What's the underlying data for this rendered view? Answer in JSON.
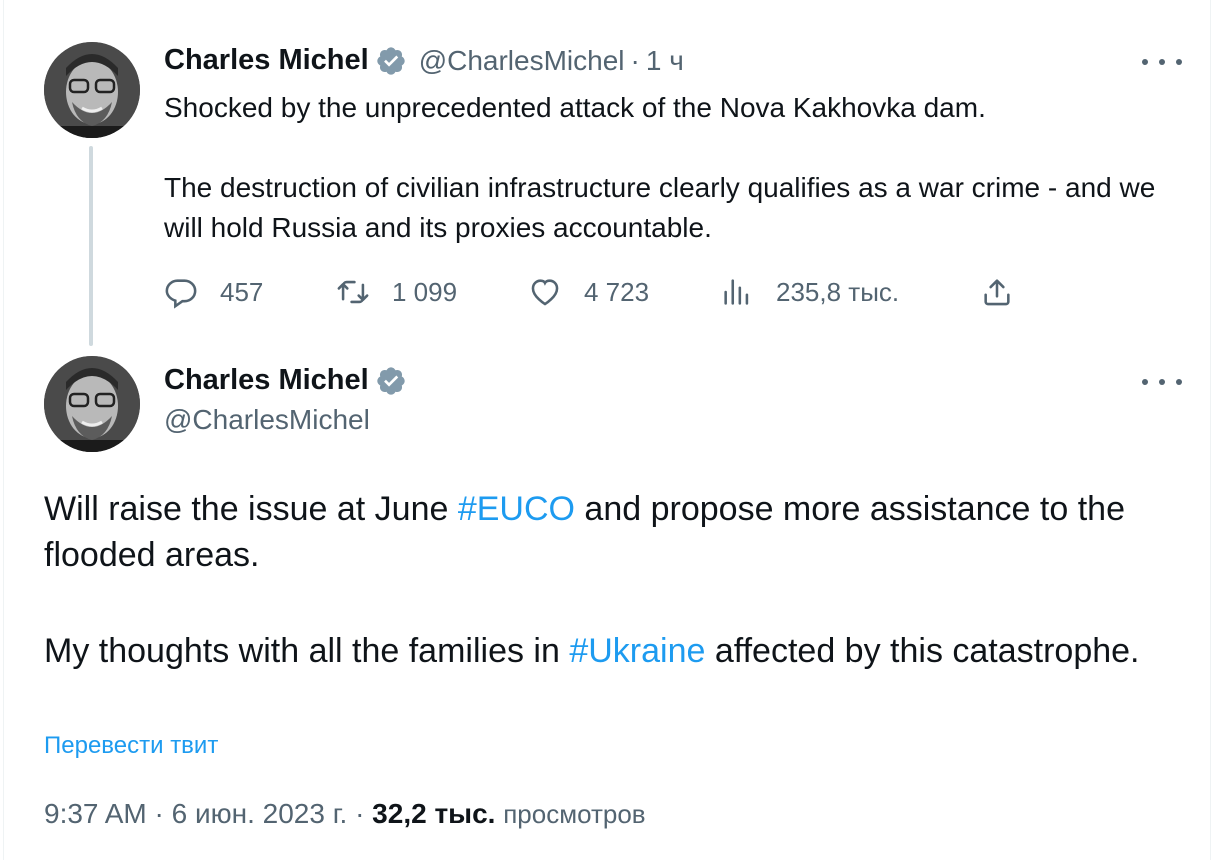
{
  "tweet1": {
    "author_name": "Charles Michel",
    "handle": "@CharlesMichel",
    "separator": "·",
    "time": "1 ч",
    "text": [
      "Shocked by the unprecedented attack of the Nova Kakhovka dam.",
      "The destruction of civilian infrastructure clearly qualifies as a war crime - and we will hold Russia and its proxies accountable."
    ],
    "replies": "457",
    "retweets": "1 099",
    "likes": "4 723",
    "views": "235,8 тыс."
  },
  "tweet2": {
    "author_name": "Charles Michel",
    "handle": "@CharlesMichel",
    "text": {
      "p1_before": "Will raise the issue at June ",
      "p1_hashtag": "#EUCO",
      "p1_after": " and propose more assistance to the flooded areas.",
      "p2_before": "My thoughts with all the families in ",
      "p2_hashtag": "#Ukraine",
      "p2_after": " affected by this catastrophe."
    },
    "translate_label": "Перевести твит",
    "time": "9:37 AM",
    "separator": "·",
    "date": "6 июн. 2023 г.",
    "views_count": "32,2 тыс.",
    "views_label": "просмотров"
  },
  "colors": {
    "text": "#0f1419",
    "secondary": "#536471",
    "link": "#1d9bf0",
    "verified_badge": "#829aab",
    "thread_line": "#cfd9de"
  },
  "icons": [
    "verified-badge-icon",
    "more-icon",
    "reply-icon",
    "retweet-icon",
    "like-icon",
    "views-icon",
    "share-icon"
  ]
}
